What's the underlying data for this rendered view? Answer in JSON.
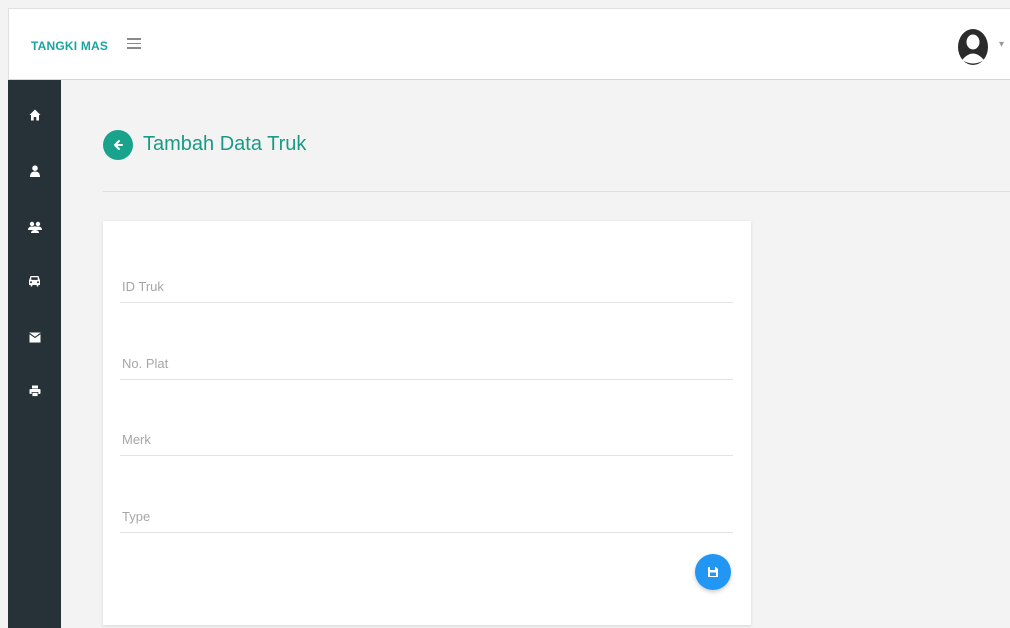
{
  "header": {
    "brand": "TANGKI MAS"
  },
  "sidebar": {
    "items": [
      {
        "icon": "home-icon"
      },
      {
        "icon": "user-icon"
      },
      {
        "icon": "users-icon"
      },
      {
        "icon": "car-icon"
      },
      {
        "icon": "envelope-icon"
      },
      {
        "icon": "print-icon"
      }
    ]
  },
  "page": {
    "title": "Tambah Data Truk"
  },
  "form": {
    "fields": [
      {
        "placeholder": "ID Truk",
        "value": ""
      },
      {
        "placeholder": "No. Plat",
        "value": ""
      },
      {
        "placeholder": "Merk",
        "value": ""
      },
      {
        "placeholder": "Type",
        "value": ""
      }
    ]
  },
  "colors": {
    "brand": "#1aa3a3",
    "sidebar": "#263238",
    "accent": "#1aa38c",
    "save_button": "#2196f3"
  }
}
